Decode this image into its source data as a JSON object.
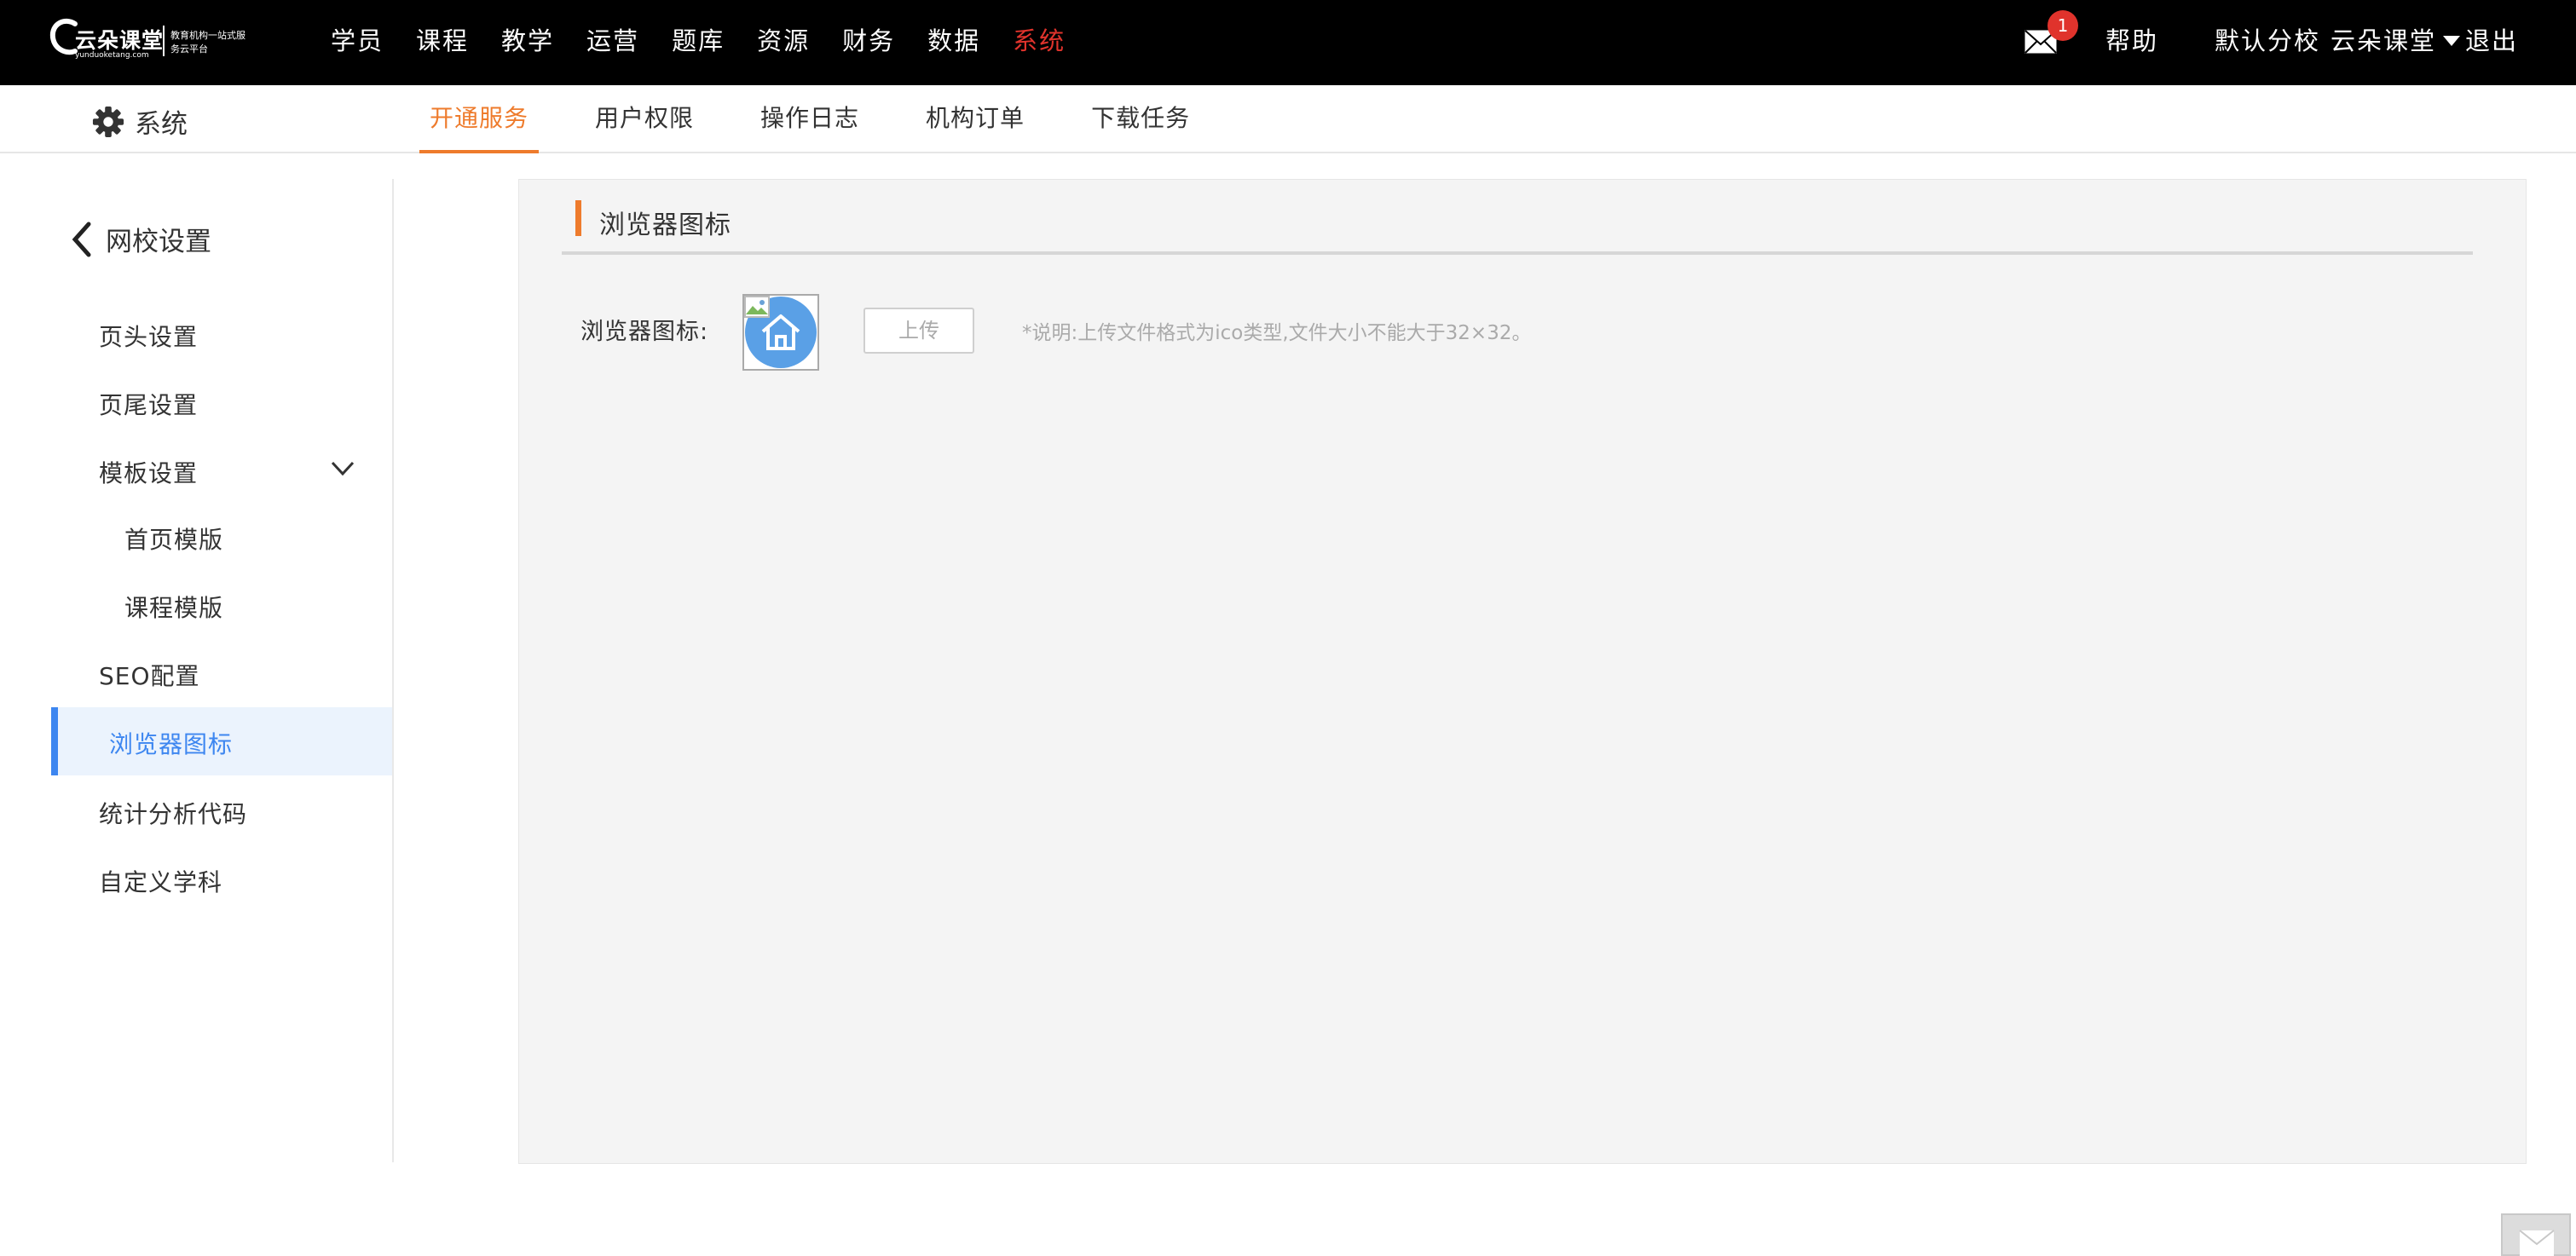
{
  "header": {
    "logo_name": "云朵课堂",
    "logo_domain": "yunduoketang.com",
    "logo_slogan": "教育机构一站式服务云平台",
    "nav": [
      "学员",
      "课程",
      "教学",
      "运营",
      "题库",
      "资源",
      "财务",
      "数据",
      "系统"
    ],
    "nav_active": "系统",
    "notification_count": "1",
    "help": "帮助",
    "branch": "默认分校",
    "org": "云朵课堂",
    "logout": "退出"
  },
  "subheader": {
    "title": "系统",
    "tabs": [
      "开通服务",
      "用户权限",
      "操作日志",
      "机构订单",
      "下载任务"
    ],
    "active_tab": "开通服务"
  },
  "sidebar": {
    "back_label": "网校设置",
    "items": [
      "页头设置",
      "页尾设置",
      "模板设置",
      "首页模版",
      "课程模版",
      "SEO配置",
      "浏览器图标",
      "统计分析代码",
      "自定义学科"
    ],
    "active_item": "浏览器图标"
  },
  "content": {
    "section_title": "浏览器图标",
    "field_label": "浏览器图标:",
    "upload_button": "上传",
    "note": "*说明:上传文件格式为ico类型,文件大小不能大于32×32。"
  },
  "colors": {
    "topbar_bg": "#000000",
    "nav_active": "#e0332c",
    "tab_active": "#ee7b2c",
    "sidebar_active": "#3d86f0",
    "sidebar_active_bg": "#ebf3fd",
    "panel_bg": "#f4f4f4"
  },
  "icons": [
    "cloud-logo",
    "mail-icon",
    "caret-down-icon",
    "gear-icon",
    "chevron-left-icon",
    "chevron-down-icon",
    "home-icon",
    "broken-image-icon"
  ]
}
